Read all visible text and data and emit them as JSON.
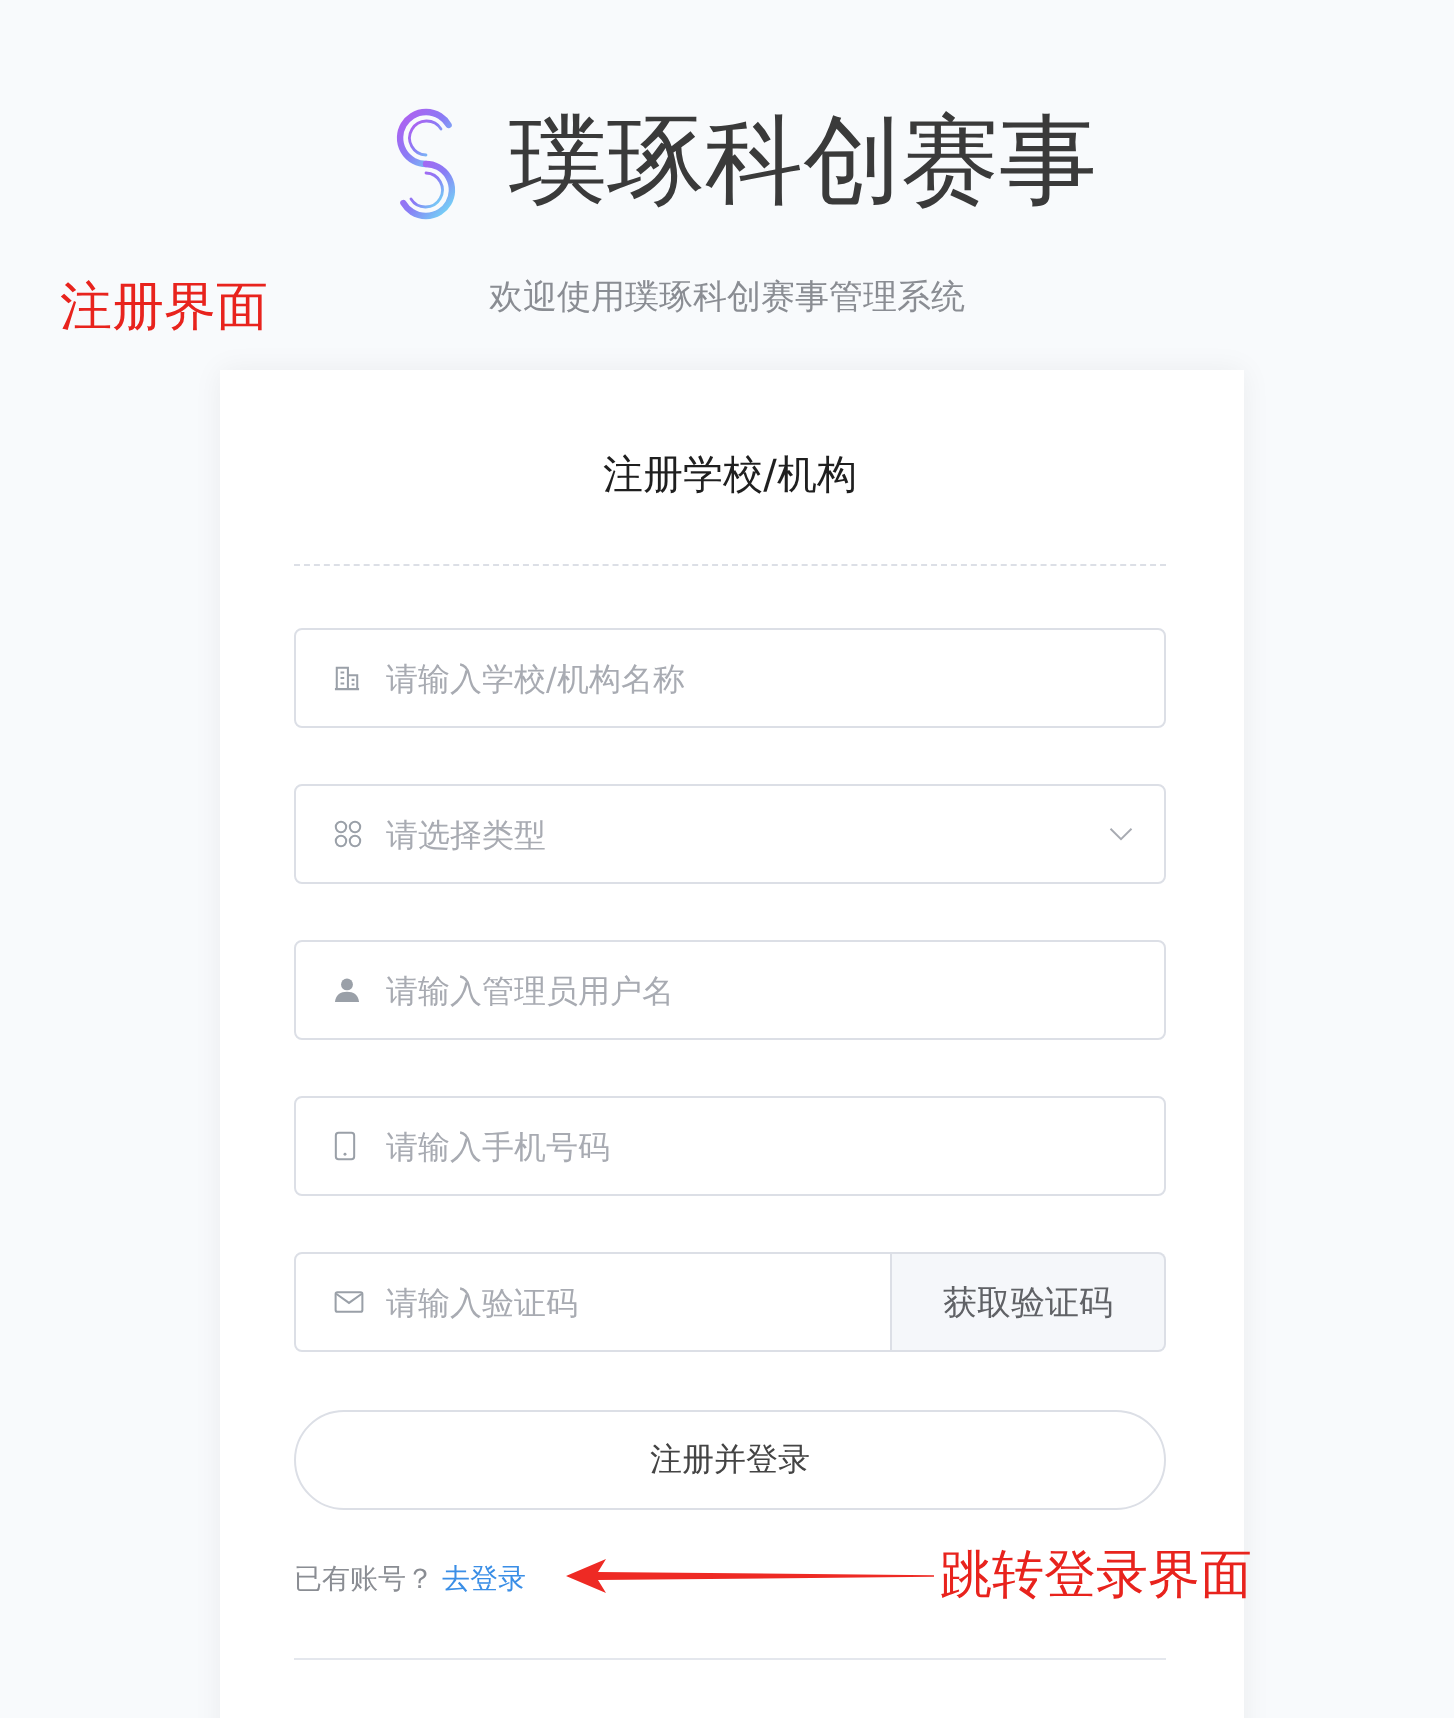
{
  "header": {
    "title": "璞琢科创赛事",
    "subtitle": "欢迎使用璞琢科创赛事管理系统"
  },
  "form": {
    "title": "注册学校/机构",
    "fields": [
      {
        "kind": "input",
        "placeholder": "请输入学校/机构名称"
      },
      {
        "kind": "select",
        "placeholder": "请选择类型"
      },
      {
        "kind": "input",
        "placeholder": "请输入管理员用户名"
      },
      {
        "kind": "input",
        "placeholder": "请输入手机号码"
      },
      {
        "kind": "code",
        "placeholder": "请输入验证码",
        "button": "获取验证码"
      }
    ],
    "submit": "注册并登录",
    "login_prompt": {
      "text": "已有账号？",
      "link": "去登录"
    }
  },
  "annotations": [
    {
      "kind": "label",
      "text": "注册界面"
    },
    {
      "kind": "arrow",
      "text": "跳转登录界面"
    }
  ]
}
